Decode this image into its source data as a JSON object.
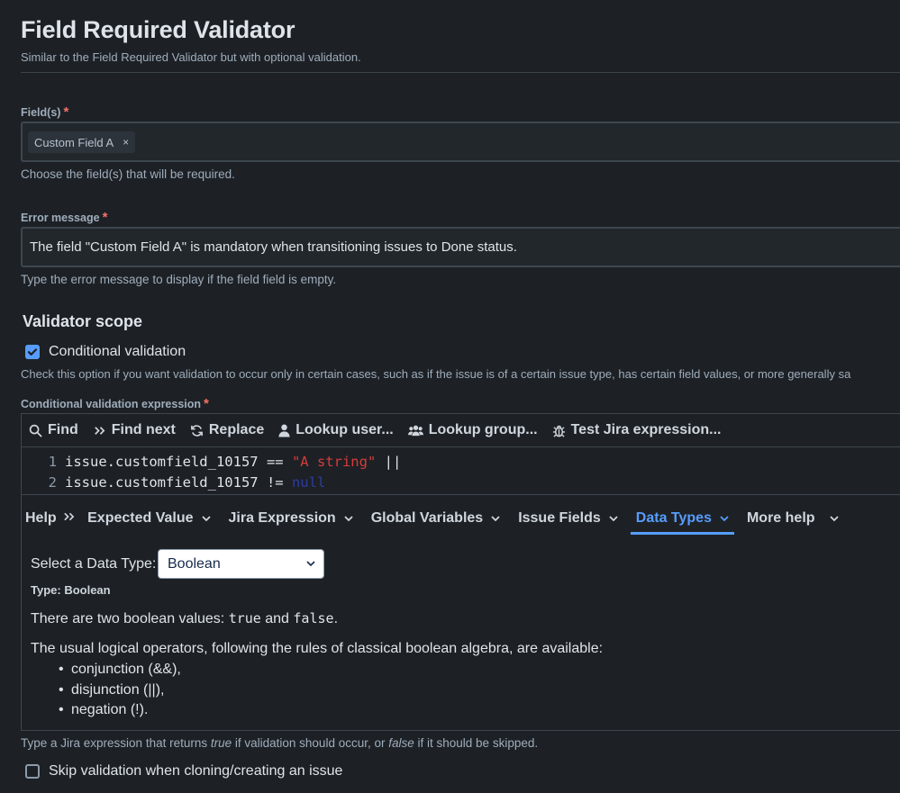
{
  "header": {
    "title": "Field Required Validator",
    "subtitle": "Similar to the Field Required Validator but with optional validation."
  },
  "fields": {
    "label": "Field(s)",
    "required_mark": "*",
    "chip_label": "Custom Field A",
    "chip_remove": "×",
    "helper": "Choose the field(s) that will be required."
  },
  "error_message": {
    "label": "Error message",
    "required_mark": "*",
    "value": "The field \"Custom Field A\" is mandatory when transitioning issues to Done status.",
    "helper": "Type the error message to display if the field field is empty."
  },
  "scope": {
    "title": "Validator scope",
    "conditional_label": "Conditional validation",
    "conditional_checked": true,
    "conditional_helper": "Check this option if you want validation to occur only in certain cases, such as if the issue is of a certain issue type, has certain field values, or more generally sa"
  },
  "expression": {
    "label": "Conditional validation expression",
    "required_mark": "*",
    "toolbar": [
      {
        "label": "Find",
        "icon": "search-icon"
      },
      {
        "label": "Find next",
        "icon": "double-chevron-icon"
      },
      {
        "label": "Replace",
        "icon": "replace-icon"
      },
      {
        "label": "Lookup user...",
        "icon": "user-icon"
      },
      {
        "label": "Lookup group...",
        "icon": "group-icon"
      },
      {
        "label": "Test Jira expression...",
        "icon": "bug-icon"
      }
    ],
    "code": [
      {
        "line": "1",
        "a": "issue.customfield_10157 == ",
        "b": "\"A string\"",
        "c": " ||"
      },
      {
        "line": "2",
        "a": "issue.customfield_10157 != ",
        "b": "null",
        "c": ""
      }
    ],
    "help_lead": "Help",
    "help_tabs": [
      {
        "label": "Expected Value",
        "active": false
      },
      {
        "label": "Jira Expression",
        "active": false
      },
      {
        "label": "Global Variables",
        "active": false
      },
      {
        "label": "Issue Fields",
        "active": false
      },
      {
        "label": "Data Types",
        "active": true
      },
      {
        "label": "More help",
        "active": false
      }
    ],
    "panel": {
      "select_label": "Select a Data Type:",
      "select_value": "Boolean",
      "type_heading": "Type: Boolean",
      "para1_pre": "There are two boolean values: ",
      "para1_true": "true",
      "para1_and": " and ",
      "para1_false": "false",
      "para1_post": ".",
      "para2": "The usual logical operators, following the rules of classical boolean algebra, are available:",
      "bullets": [
        "conjunction (&&),",
        "disjunction (||),",
        "negation (!)."
      ]
    },
    "helper_pre": "Type a Jira expression that returns ",
    "helper_true": "true",
    "helper_mid": " if validation should occur, or ",
    "helper_false": "false",
    "helper_post": " if it should be skipped."
  },
  "skip": {
    "label": "Skip validation when cloning/creating an issue",
    "checked": false
  }
}
